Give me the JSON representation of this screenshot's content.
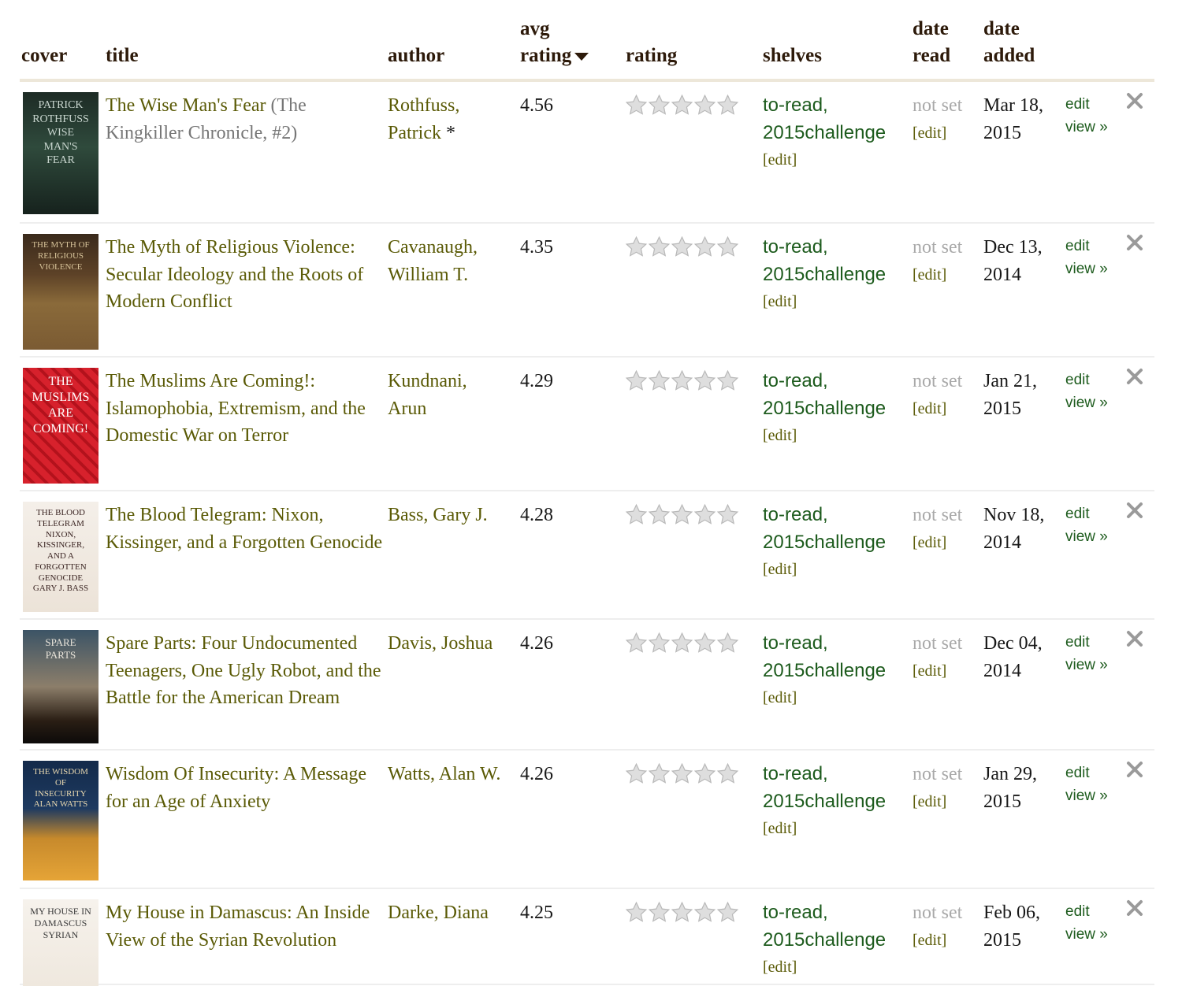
{
  "header": {
    "cover": "cover",
    "title": "title",
    "author": "author",
    "avg_rating_line1": "avg",
    "avg_rating_line2": "rating",
    "rating": "rating",
    "shelves": "shelves",
    "date_read_line1": "date",
    "date_read_line2": "read",
    "date_added_line1": "date",
    "date_added_line2": "added"
  },
  "labels": {
    "edit_bracket": "[edit]",
    "not_set": "not set",
    "edit": "edit",
    "view": "view »"
  },
  "colors": {
    "link_olive": "#5a5a06",
    "shelf_green": "#1d5b1d",
    "header_brown": "#2d1a0a",
    "muted_gray": "#a9a9a9"
  },
  "books": [
    {
      "title": "The Wise Man's Fear",
      "series": " (The Kingkiller Chronicle, #2)",
      "author_line1": "Rothfuss,",
      "author_line2": "Patrick",
      "author_mark": " *",
      "avg_rating": "4.56",
      "user_rating_stars": 0,
      "shelf1": "to-read,",
      "shelf2": "2015challenge",
      "date_added_line1": "Mar 18,",
      "date_added_line2": "2015",
      "cover_text": [
        "PATRICK",
        "ROTHFUSS",
        "WISE",
        "MAN'S",
        "FEAR"
      ]
    },
    {
      "title": "The Myth of Religious Violence: Secular Ideology and the Roots of Modern Conflict",
      "series": "",
      "author_line1": "Cavanaugh,",
      "author_line2": "William T.",
      "author_mark": "",
      "avg_rating": "4.35",
      "user_rating_stars": 0,
      "shelf1": "to-read,",
      "shelf2": "2015challenge",
      "date_added_line1": "Dec 13,",
      "date_added_line2": "2014",
      "cover_text": [
        "THE MYTH OF",
        "RELIGIOUS",
        "VIOLENCE"
      ]
    },
    {
      "title": "The Muslims Are Coming!: Islamophobia, Extremism, and the Domestic War on Terror",
      "series": "",
      "author_line1": "Kundnani,",
      "author_line2": "Arun",
      "author_mark": "",
      "avg_rating": "4.29",
      "user_rating_stars": 0,
      "shelf1": "to-read,",
      "shelf2": "2015challenge",
      "date_added_line1": "Jan 21,",
      "date_added_line2": "2015",
      "cover_text": [
        "THE",
        "MUSLIMS",
        "ARE",
        "COMING!"
      ]
    },
    {
      "title": "The Blood Telegram: Nixon, Kissinger, and a Forgotten Genocide",
      "series": "",
      "author_line1": "Bass, Gary J.",
      "author_line2": "",
      "author_mark": "",
      "avg_rating": "4.28",
      "user_rating_stars": 0,
      "shelf1": "to-read,",
      "shelf2": "2015challenge",
      "date_added_line1": "Nov 18,",
      "date_added_line2": "2014",
      "cover_text": [
        "THE BLOOD",
        "TELEGRAM",
        "NIXON,",
        "KISSINGER,",
        "AND A",
        "FORGOTTEN",
        "GENOCIDE",
        "GARY J. BASS"
      ]
    },
    {
      "title": "Spare Parts: Four Undocumented Teenagers, One Ugly Robot, and the Battle for the American Dream",
      "series": "",
      "author_line1": "Davis, Joshua",
      "author_line2": "",
      "author_mark": "",
      "avg_rating": "4.26",
      "user_rating_stars": 0,
      "shelf1": "to-read,",
      "shelf2": "2015challenge",
      "date_added_line1": "Dec 04,",
      "date_added_line2": "2014",
      "cover_text": [
        "SPARE",
        "PARTS"
      ]
    },
    {
      "title": "Wisdom Of Insecurity: A Message for an Age of Anxiety",
      "series": "",
      "author_line1": "Watts, Alan W.",
      "author_line2": "",
      "author_mark": "",
      "avg_rating": "4.26",
      "user_rating_stars": 0,
      "shelf1": "to-read,",
      "shelf2": "2015challenge",
      "date_added_line1": "Jan 29,",
      "date_added_line2": "2015",
      "cover_text": [
        "THE WISDOM",
        "OF",
        "INSECURITY",
        "ALAN WATTS"
      ]
    },
    {
      "title": "My House in Damascus: An Inside View of the Syrian Revolution",
      "series": "",
      "author_line1": "Darke, Diana",
      "author_line2": "",
      "author_mark": "",
      "avg_rating": "4.25",
      "user_rating_stars": 0,
      "shelf1": "to-read,",
      "shelf2": "2015challenge",
      "date_added_line1": "Feb 06,",
      "date_added_line2": "2015",
      "cover_text": [
        "MY HOUSE IN",
        "DAMASCUS",
        "SYRIAN"
      ]
    }
  ]
}
